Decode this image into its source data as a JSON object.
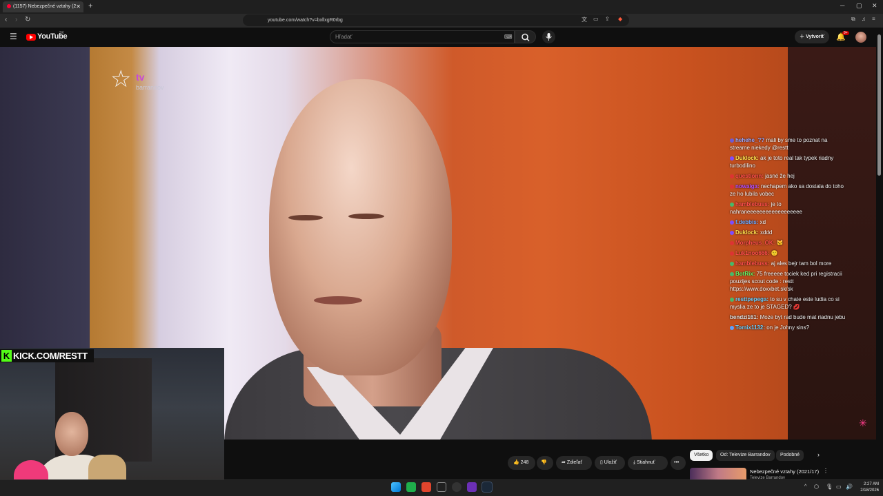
{
  "browser": {
    "tab_title": "(1157) Nebezpečné vztahy (2",
    "new_tab": "+",
    "url": "youtube.com/watch?v=bxllxgR0rbg",
    "window_controls": [
      "─",
      "▢",
      "✕"
    ]
  },
  "youtube": {
    "logo_text": "YouTube",
    "region": "SK",
    "search_placeholder": "Hľadať",
    "create_label": "Vytvoriť",
    "notifications_badge": "9+"
  },
  "video": {
    "channel_logo_tv": "tv",
    "channel_logo_name": "barrandov",
    "kick_banner": "KICK.COM/RESTT",
    "kick_letter": "K"
  },
  "chat": [
    {
      "user": "hehehe_?? ",
      "text": "mali by sme to poznat na streame niekedy @restt",
      "color": "#9aa8ff",
      "icon": "#6b5bd6"
    },
    {
      "user": "Duklock:",
      "text": "ak je toto real tak typek riadny turbodilino",
      "color": "#ffe04d",
      "icon": "#7c4dff"
    },
    {
      "user": "questionn:",
      "text": "jasné že hej",
      "color": "#ff4d4d",
      "icon": "#d33"
    },
    {
      "user": "nowaiga:",
      "text": "nechapem ako sa dostala do toho ze ho lubila vobec",
      "color": "#b44dff",
      "icon": "#d33"
    },
    {
      "user": "hamblebuss:",
      "text": "je to nahraneeeeeeeeeeeeeeeeee",
      "color": "#ff4d4d",
      "icon": "#46b96a"
    },
    {
      "user": "f.debbis:",
      "text": "xd",
      "color": "#6aa7ff",
      "icon": "#7c4dff"
    },
    {
      "user": "Duklock:",
      "text": "xddd",
      "color": "#ffe04d",
      "icon": "#7c4dff"
    },
    {
      "user": "Morpheus_OK:",
      "text": "🐱",
      "color": "#ff4d4d",
      "icon": "#d33"
    },
    {
      "user": "Luk1noo666:",
      "text": "🙂",
      "color": "#ff4d4d",
      "icon": "#d33"
    },
    {
      "user": "hamblebuss:",
      "text": "aj ales bejr tam bol more",
      "color": "#ff4d4d",
      "icon": "#46b96a"
    },
    {
      "user": "BotRix:",
      "text": "75 freeeee tociek ked pri registracii pouzijes scout code : restt https://www.doxxbet.sk/sk",
      "color": "#5cff6a",
      "icon": "#46b96a"
    },
    {
      "user": "resttpepega:",
      "text": "to su v chate este ludia co si myslia ze to je STAGED? 💋",
      "color": "#6ad0ff",
      "icon": "#46b96a"
    },
    {
      "user": "bendzi161:",
      "text": "Moze byt rad bude mat riadnu jebu",
      "color": "#e0e0e0",
      "icon": ""
    },
    {
      "user": "Tomix1132:",
      "text": "on je Johny sins?",
      "color": "#6ad0ff",
      "icon": "#5aa0ff"
    }
  ],
  "actions": {
    "likes": "248",
    "share": "Zdieľať",
    "save": "Uložiť",
    "download": "Stiahnuť",
    "more": "•••"
  },
  "chips": [
    "Všetko",
    "Od: Televize Barrandov",
    "Podobné"
  ],
  "recommendation": {
    "title": "Nebezpečné vztahy (2021/17)",
    "channel": "Televize Barrandov"
  },
  "taskbar": {
    "time": "2:27 AM",
    "date": "2/18/2026"
  }
}
